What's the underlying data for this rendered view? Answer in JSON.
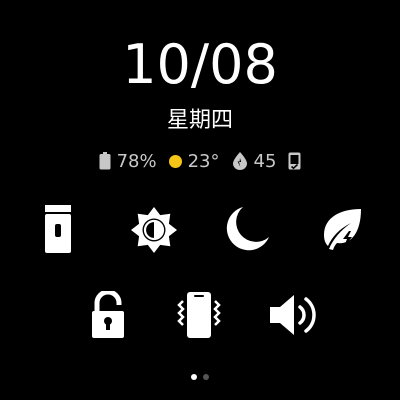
{
  "date": "10/08",
  "weekday": "星期四",
  "status": {
    "battery": "78%",
    "temperature": "23°",
    "air_quality": "45",
    "battery_icon": "battery-icon",
    "weather_icon": "sun-icon",
    "air_icon": "air-quality-drop-icon",
    "phone_icon": "phone-connected-icon",
    "weather_color": "#f5c518"
  },
  "quick_settings": {
    "row1": [
      {
        "icon": "flashlight-icon"
      },
      {
        "icon": "brightness-icon"
      },
      {
        "icon": "do-not-disturb-moon-icon"
      },
      {
        "icon": "power-saving-leaf-icon"
      }
    ],
    "row2": [
      {
        "icon": "lock-icon"
      },
      {
        "icon": "vibrate-icon"
      },
      {
        "icon": "sound-icon"
      }
    ]
  },
  "pager": {
    "pages": 2,
    "active_index": 0,
    "active_color": "#ffffff",
    "inactive_color": "#555555"
  }
}
